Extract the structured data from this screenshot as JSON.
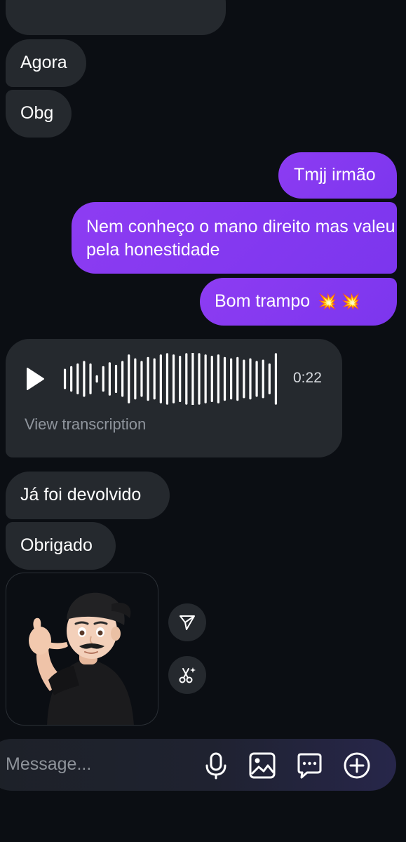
{
  "messages": {
    "incoming_1": "Agora",
    "incoming_2": "Obg",
    "outgoing_1": "Tmjj irmão",
    "outgoing_2": "Nem conheço o mano direito mas valeu pela honestidade",
    "outgoing_3": "Bom trampo",
    "outgoing_3_emoji": "💥 💥",
    "incoming_3": "Já foi devolvido",
    "incoming_4": "Obrigado"
  },
  "voice_message": {
    "duration": "0:22",
    "transcription_label": "View transcription",
    "waveform_levels": [
      0.35,
      0.45,
      0.55,
      0.65,
      0.55,
      0.1,
      0.45,
      0.6,
      0.5,
      0.65,
      0.9,
      0.75,
      0.65,
      0.8,
      0.75,
      0.9,
      0.95,
      0.9,
      0.85,
      0.95,
      1.0,
      0.95,
      0.9,
      0.85,
      0.9,
      0.8,
      0.75,
      0.8,
      0.7,
      0.75,
      0.65,
      0.7,
      0.55,
      0.95
    ]
  },
  "sticker": {
    "description_icon": "memoji-call-me-icon"
  },
  "actions": {
    "share_icon": "send-icon",
    "remix_icon": "remix-icon"
  },
  "composer": {
    "placeholder": "Message...",
    "icons": [
      "microphone-icon",
      "gallery-icon",
      "sticker-icon",
      "plus-icon"
    ]
  },
  "colors": {
    "background": "#0b0e13",
    "incoming_bubble": "#25292e",
    "outgoing_bubble": "#8d3cf2",
    "secondary_text": "#8f959d"
  }
}
